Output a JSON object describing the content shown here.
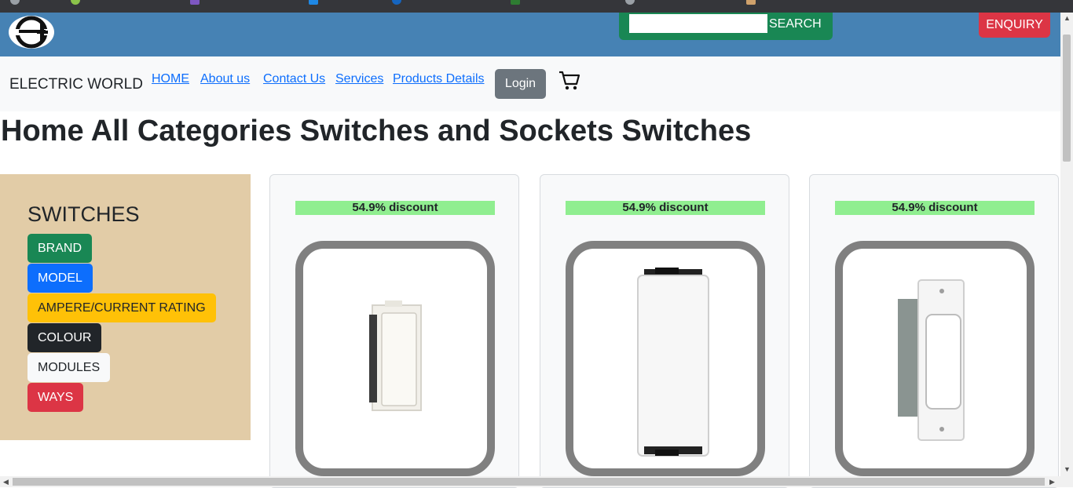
{
  "header": {
    "search_placeholder": "",
    "search_label": "SEARCH",
    "enquiry_label": "ENQUIRY"
  },
  "navbar": {
    "brand": "ELECTRIC WORLD",
    "links": [
      "HOME",
      "About us",
      "Contact Us",
      "Services",
      "Products Details"
    ],
    "login_label": "Login"
  },
  "page": {
    "title": "Home All Categories Switches and Sockets Switches"
  },
  "sidebar": {
    "title": "SWITCHES",
    "filters": [
      "BRAND",
      "MODEL",
      "AMPERE/CURRENT RATING",
      "COLOUR",
      "MODULES",
      "WAYS"
    ]
  },
  "products": [
    {
      "discount": "54.9% discount"
    },
    {
      "discount": "54.9% discount"
    },
    {
      "discount": "54.9% discount"
    }
  ],
  "colors": {
    "header_bg": "#4682b4",
    "search_bg": "#198754",
    "enquiry_bg": "#dc3545",
    "sidebar_bg": "#e2cca7",
    "discount_bg": "#90ee90",
    "brand_filter": "#198754",
    "model_filter": "#0d6efd",
    "ampere_filter": "#ffc107",
    "colour_filter": "#212529",
    "modules_filter": "#f8f9fa",
    "ways_filter": "#dc3545"
  },
  "icons": [
    "logo-icon",
    "cart-icon"
  ]
}
